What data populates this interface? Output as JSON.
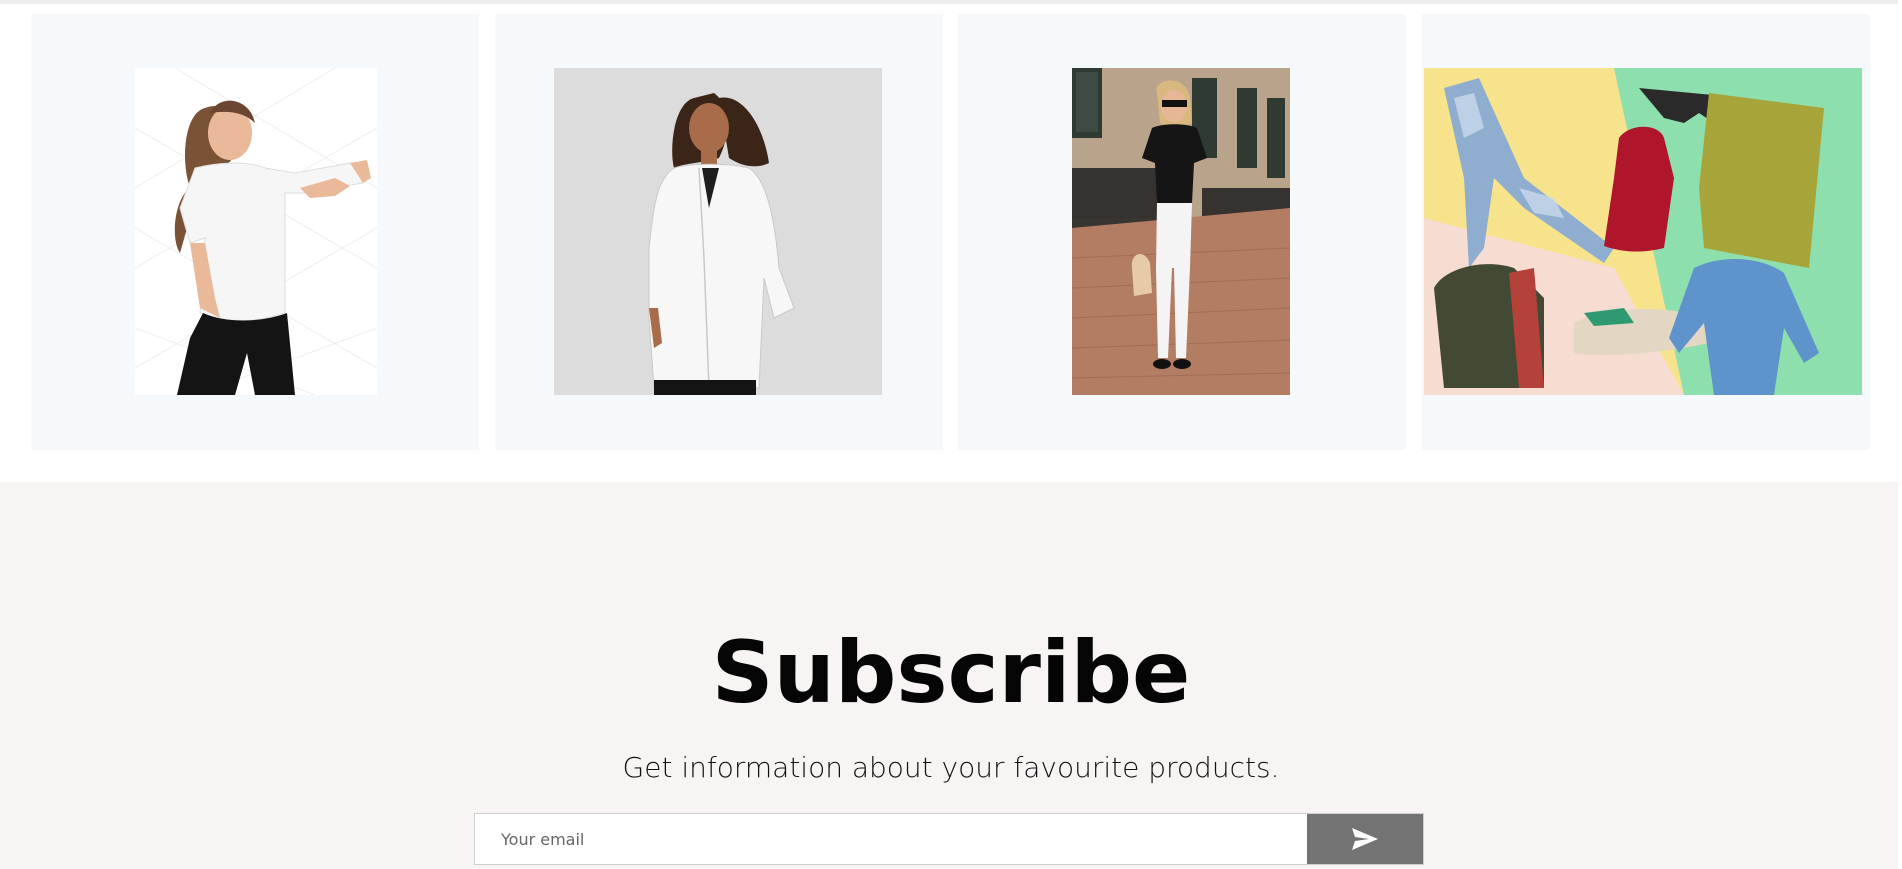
{
  "products": {
    "cards": [
      {
        "image": "woman-white-tshirt-pointing-photo"
      },
      {
        "image": "woman-white-lab-coat-photo"
      },
      {
        "image": "woman-black-top-white-jeans-street-photo"
      },
      {
        "image": "clothing-flat-lay-collage-photo"
      }
    ]
  },
  "subscribe": {
    "title": "Subscribe",
    "text": "Get information about your favourite products.",
    "email_placeholder": "Your email",
    "send_icon": "paper-plane-icon"
  },
  "colors": {
    "card_background": "#f5f9fb",
    "section_background": "#f8f4f4",
    "button_background": "#737373",
    "button_icon": "#ffffff"
  }
}
